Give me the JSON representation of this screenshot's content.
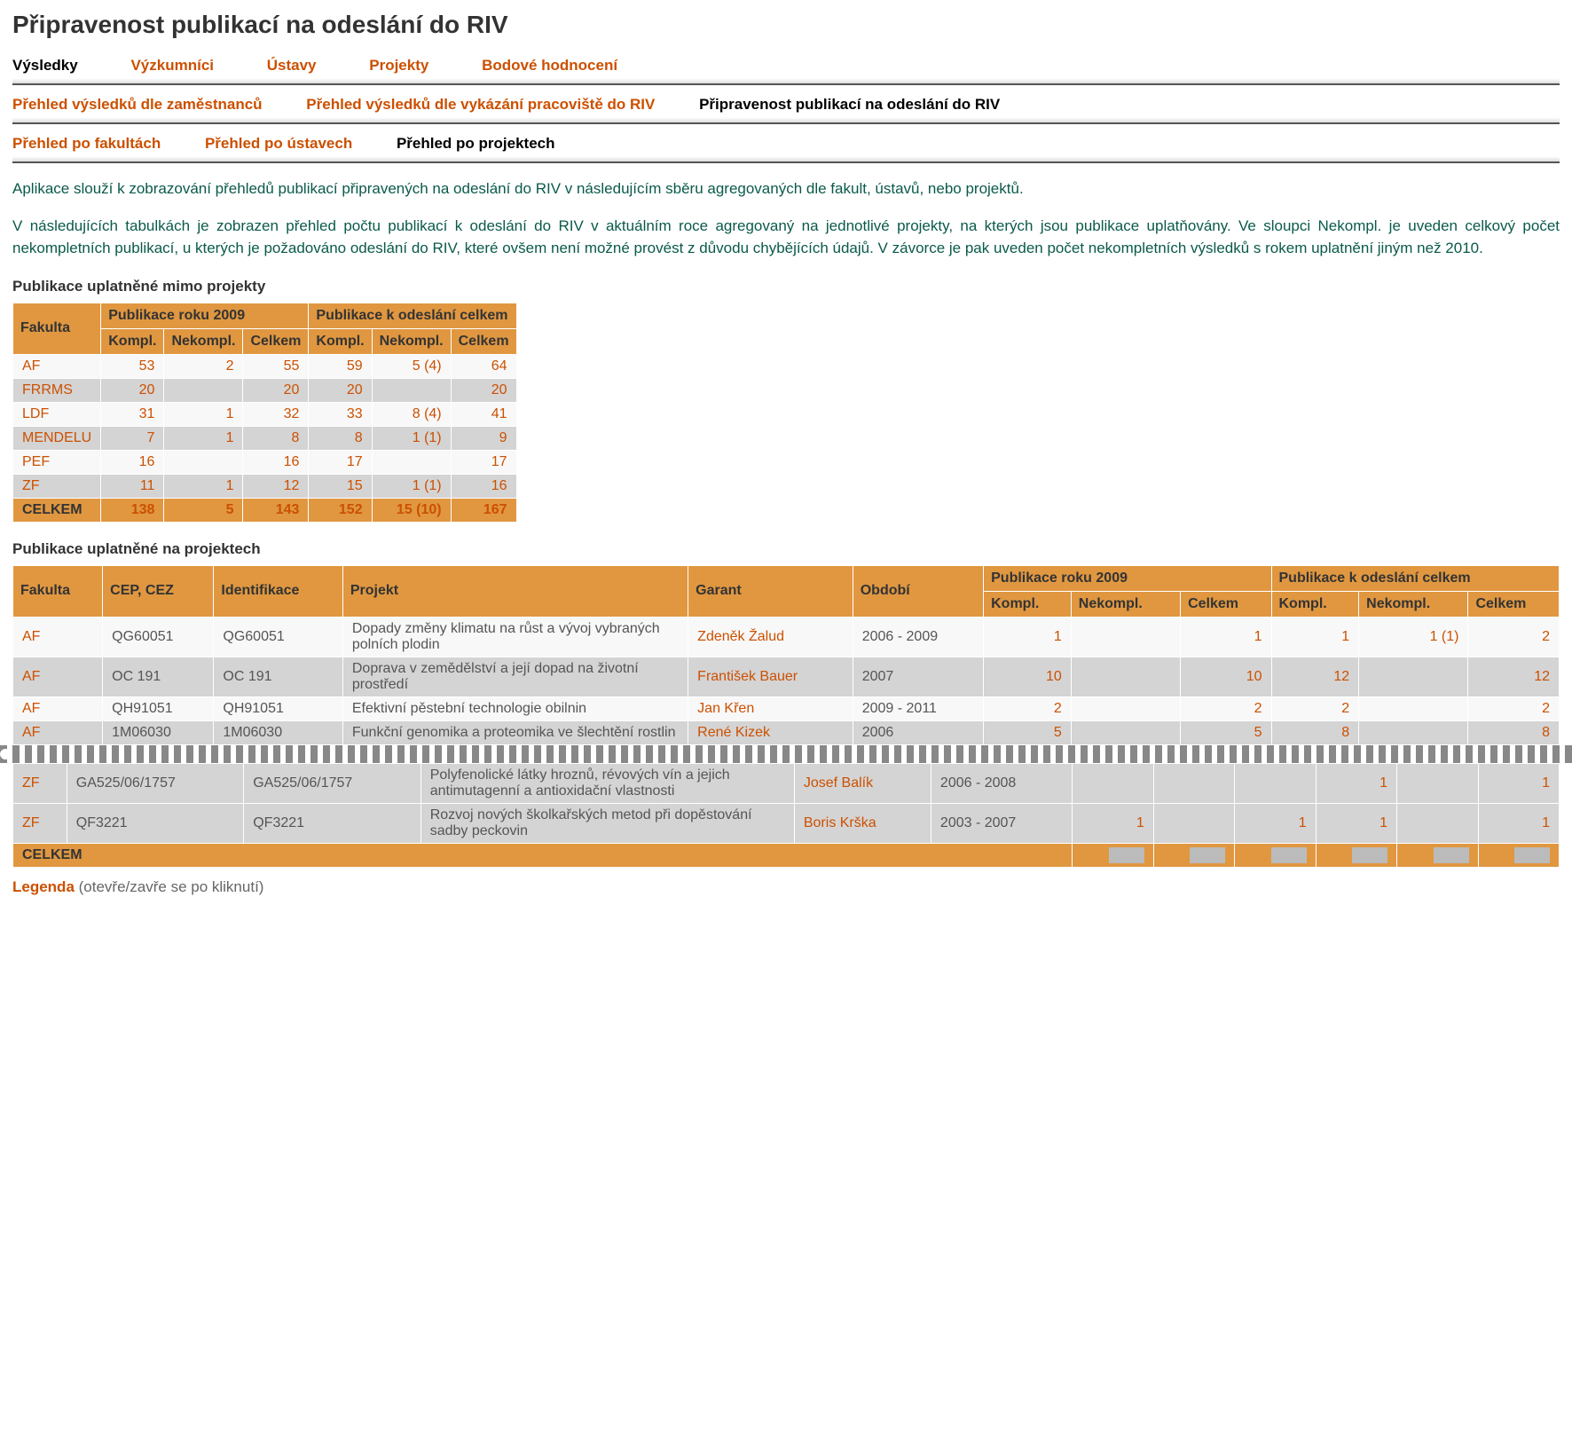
{
  "title": "Připravenost publikací na odeslání do RIV",
  "tabs1": {
    "vysledky": "Výsledky",
    "vyzkumnici": "Výzkumníci",
    "ustavy": "Ústavy",
    "projekty": "Projekty",
    "bodove": "Bodové hodnocení"
  },
  "tabs2": {
    "a": "Přehled výsledků dle zaměstnanců",
    "b": "Přehled výsledků dle vykázání pracoviště do RIV",
    "c": "Připravenost publikací na odeslání do RIV"
  },
  "tabs3": {
    "a": "Přehled po fakultách",
    "b": "Přehled po ústavech",
    "c": "Přehled po projektech"
  },
  "intro1": "Aplikace slouží k zobrazování přehledů publikací připravených na odeslání do RIV v následujícím sběru agregovaných dle fakult, ústavů, nebo projektů.",
  "intro2": "V následujících tabulkách je zobrazen přehled počtu publikací k odeslání do RIV v aktuálním roce agregovaný na jednotlivé projekty, na kterých jsou publikace uplatňovány. Ve sloupci Nekompl. je uveden celkový počet nekompletních publikací, u kterých je požadováno odeslání do RIV, které ovšem není možné provést z důvodu chybějících údajů. V závorce je pak uveden počet nekompletních výsledků s rokem uplatnění jiným než 2010.",
  "h_t1": "Publikace uplatněné mimo projekty",
  "h_t2": "Publikace uplatněné na projektech",
  "th": {
    "fak": "Fakulta",
    "p09": "Publikace roku 2009",
    "pod": "Publikace k odeslání celkem",
    "kompl": "Kompl.",
    "nekompl": "Nekompl.",
    "celkem": "Celkem",
    "celkem_row": "CELKEM",
    "cep": "CEP, CEZ",
    "ident": "Identifikace",
    "proj": "Projekt",
    "garant": "Garant",
    "obd": "Období"
  },
  "t1": [
    {
      "f": "AF",
      "k1": "53",
      "n1": "2",
      "c1": "55",
      "k2": "59",
      "n2": "5 (4)",
      "c2": "64"
    },
    {
      "f": "FRRMS",
      "k1": "20",
      "n1": "",
      "c1": "20",
      "k2": "20",
      "n2": "",
      "c2": "20"
    },
    {
      "f": "LDF",
      "k1": "31",
      "n1": "1",
      "c1": "32",
      "k2": "33",
      "n2": "8 (4)",
      "c2": "41"
    },
    {
      "f": "MENDELU",
      "k1": "7",
      "n1": "1",
      "c1": "8",
      "k2": "8",
      "n2": "1 (1)",
      "c2": "9"
    },
    {
      "f": "PEF",
      "k1": "16",
      "n1": "",
      "c1": "16",
      "k2": "17",
      "n2": "",
      "c2": "17"
    },
    {
      "f": "ZF",
      "k1": "11",
      "n1": "1",
      "c1": "12",
      "k2": "15",
      "n2": "1 (1)",
      "c2": "16"
    }
  ],
  "t1tot": {
    "k1": "138",
    "n1": "5",
    "c1": "143",
    "k2": "152",
    "n2": "15 (10)",
    "c2": "167"
  },
  "t2": [
    {
      "f": "AF",
      "cep": "QG60051",
      "id": "QG60051",
      "pr": "Dopady změny klimatu na růst a vývoj vybraných polních plodin",
      "g": "Zdeněk Žalud",
      "o": "2006 - 2009",
      "k1": "1",
      "n1": "",
      "c1": "1",
      "k2": "1",
      "n2": "1 (1)",
      "c2": "2"
    },
    {
      "f": "AF",
      "cep": "OC 191",
      "id": "OC 191",
      "pr": "Doprava v zemědělství a její dopad na životní prostředí",
      "g": "František Bauer",
      "o": "2007",
      "k1": "10",
      "n1": "",
      "c1": "10",
      "k2": "12",
      "n2": "",
      "c2": "12"
    },
    {
      "f": "AF",
      "cep": "QH91051",
      "id": "QH91051",
      "pr": "Efektivní pěstební technologie obilnin",
      "g": "Jan Křen",
      "o": "2009 - 2011",
      "k1": "2",
      "n1": "",
      "c1": "2",
      "k2": "2",
      "n2": "",
      "c2": "2"
    },
    {
      "f": "AF",
      "cep": "1M06030",
      "id": "1M06030",
      "pr": "Funkční genomika a proteomika ve šlechtění rostlin",
      "g": "René Kizek",
      "o": "2006",
      "k1": "5",
      "n1": "",
      "c1": "5",
      "k2": "8",
      "n2": "",
      "c2": "8"
    }
  ],
  "t2b": [
    {
      "f": "ZF",
      "cep": "GA525/06/1757",
      "id": "GA525/06/1757",
      "pr": "Polyfenolické látky hroznů, révových vín a jejich antimutagenní a antioxidační vlastnosti",
      "g": "Josef Balík",
      "o": "2006 - 2008",
      "k1": "",
      "n1": "",
      "c1": "",
      "k2": "1",
      "n2": "",
      "c2": "1"
    },
    {
      "f": "ZF",
      "cep": "QF3221",
      "id": "QF3221",
      "pr": "Rozvoj nových školkařských metod při dopěstování sadby peckovin",
      "g": "Boris Krška",
      "o": "2003 - 2007",
      "k1": "1",
      "n1": "",
      "c1": "1",
      "k2": "1",
      "n2": "",
      "c2": "1"
    }
  ],
  "legend": {
    "label": "Legenda",
    "note": "(otevře/zavře se po kliknutí)"
  }
}
